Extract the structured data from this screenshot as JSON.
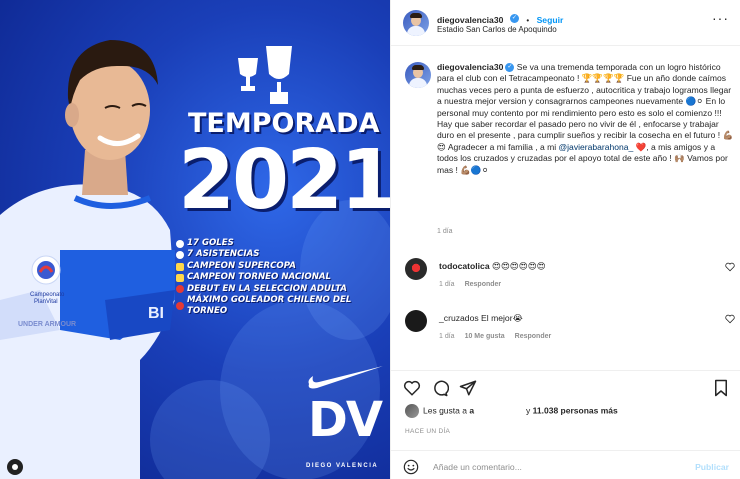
{
  "poster": {
    "headline": "TEMPORADA",
    "year": "2021",
    "stats": [
      "17 GOLES",
      "7 ASISTENCIAS",
      "CAMPEON SUPERCOPA",
      "CAMPEON TORNEO NACIONAL",
      "DEBUT EN LA SELECCION ADULTA",
      "MÁXIMO GOLEADOR CHILENO DEL TORNEO"
    ],
    "monogram": "DV",
    "player_name": "DIEGO VALENCIA",
    "brand_icon": "nike-swoosh-icon",
    "colors": {
      "primary": "#1a3fb8",
      "accent": "#ffffff"
    }
  },
  "header": {
    "username": "diegovalencia30",
    "separator": "•",
    "follow_label": "Seguir",
    "location": "Estadio San Carlos de Apoquindo",
    "more_label": "···"
  },
  "caption": {
    "username": "diegovalencia30",
    "text_part1": " Se va una tremenda temporada con un logro histórico para el club con el Tetracampeonato ! 🏆🏆🏆🏆 Fue un año donde caímos muchas veces pero a punta de esfuerzo , autocritica y trabajo logramos llegar a nuestra mejor version y consagrarnos campeones nuevamente 🔵⚪ En lo personal muy contento por mi rendimiento pero esto es solo el comienzo !!! Hay que saber recordar el pasado pero no vivir de él , enfocarse y trabajar duro en el presente , para cumplir sueños y recibir la cosecha en el futuro ! 💪🏽😍 Agradecer a mi familia , a mi ",
    "mention": "@javierabarahona_",
    "text_part2": " ❤️, a mis amigos y a todos los cruzados y cruzadas por el apoyo total de este año ! 🙌🏽 Vamos por mas ! 💪🏽🔵⚪",
    "time": "1 día"
  },
  "comments": [
    {
      "username": "todocatolica",
      "text": "😍😍😍😍😍😍",
      "time": "1 día",
      "reply_label": "Responder",
      "likes": ""
    },
    {
      "username": "_cruzados",
      "text": "El mejor😭",
      "time": "1 día",
      "likes": "10 Me gusta",
      "reply_label": "Responder"
    }
  ],
  "likes": {
    "prefix": "Les gusta a",
    "user": "a",
    "middle": "y",
    "count": "11.038 personas más"
  },
  "posted_ago": "HACE UN DÍA",
  "add_comment": {
    "placeholder": "Añade un comentario...",
    "post_label": "Publicar"
  },
  "icons": [
    "heart-icon",
    "comment-icon",
    "share-icon",
    "bookmark-icon",
    "emoji-icon",
    "more-icon",
    "verified-icon"
  ]
}
